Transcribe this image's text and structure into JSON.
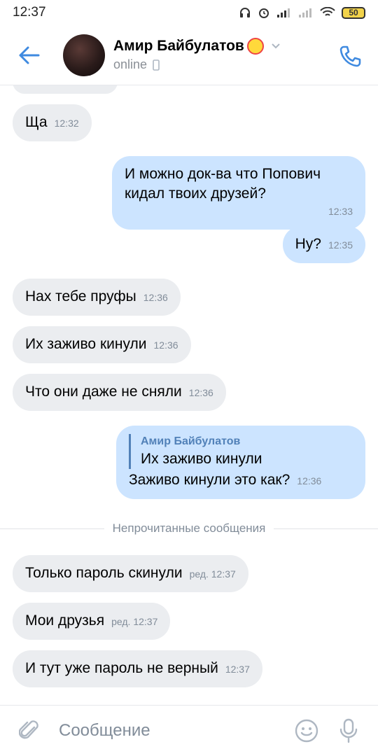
{
  "status_bar": {
    "time": "12:37",
    "battery": "50"
  },
  "header": {
    "name": "Амир Байбулатов",
    "status": "online"
  },
  "messages": [
    {
      "direction": "in",
      "text": "Ща",
      "time": "12:32"
    },
    {
      "direction": "out",
      "text_line1": "И можно док-ва что Попович",
      "text_line2": "кидал твоих друзей?",
      "time": "12:33"
    },
    {
      "direction": "out",
      "text": "Ну?",
      "time": "12:35"
    },
    {
      "direction": "in",
      "text": "Нах тебе пруфы",
      "time": "12:36"
    },
    {
      "direction": "in",
      "text": "Их заживо кинули",
      "time": "12:36"
    },
    {
      "direction": "in",
      "text": "Что они даже не сняли",
      "time": "12:36"
    },
    {
      "direction": "out",
      "quote_author": "Амир Байбулатов",
      "quote_text": "Их заживо кинули",
      "text": "Заживо кинули это как?",
      "time": "12:36"
    },
    {
      "direction": "in",
      "text": "Только пароль скинули",
      "time": "ред. 12:37"
    },
    {
      "direction": "in",
      "text": "Мои друзья",
      "time": "ред. 12:37"
    },
    {
      "direction": "in",
      "text": "И тут уже пароль не верный",
      "time": "12:37"
    }
  ],
  "unread_divider": "Непрочитанные сообщения",
  "composer": {
    "placeholder": "Сообщение"
  },
  "colors": {
    "accent": "#5181b8",
    "incoming_bubble": "#ebedf0",
    "outgoing_bubble": "#cce4ff",
    "secondary_text": "#818c99"
  }
}
